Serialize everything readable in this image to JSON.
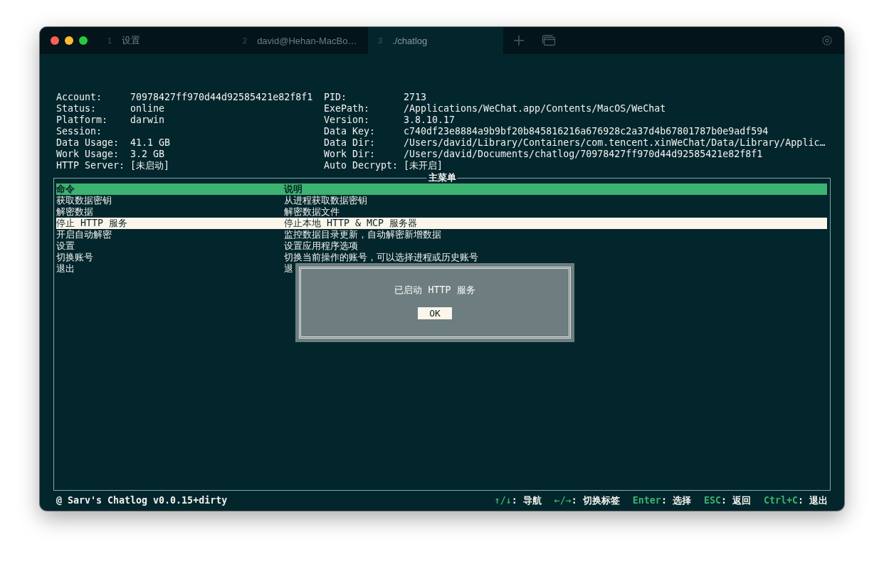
{
  "tabs": [
    {
      "number": "1",
      "title": "设置",
      "selected": false
    },
    {
      "number": "2",
      "title": "david@Hehan-MacBo…",
      "selected": false
    },
    {
      "number": "3",
      "title": "./chatlog",
      "selected": true
    }
  ],
  "info_left": [
    {
      "label": "Account:",
      "value": "70978427ff970d44d92585421e82f8f1"
    },
    {
      "label": "Status:",
      "value": "online"
    },
    {
      "label": "Platform:",
      "value": "darwin"
    },
    {
      "label": "Session:"
    },
    {
      "label": "Data Usage:",
      "value": "41.1 GB"
    },
    {
      "label": "Work Usage:",
      "value": "3.2 GB"
    },
    {
      "label": "HTTP Server:",
      "value": "[未启动]"
    }
  ],
  "info_right": [
    {
      "label": "PID:",
      "value": "2713"
    },
    {
      "label": "ExePath:",
      "value": "/Applications/WeChat.app/Contents/MacOS/WeChat"
    },
    {
      "label": "Version:",
      "value": "3.8.10.17"
    },
    {
      "label": "Data Key:",
      "value": "c740df23e8884a9b9bf20b845816216a676928c2a37d4b67801787b0e9adf594"
    },
    {
      "label": "Data Dir:",
      "value": "/Users/david/Library/Containers/com.tencent.xinWeChat/Data/Library/Applic…"
    },
    {
      "label": "Work Dir:",
      "value": "/Users/david/Documents/chatlog/70978427ff970d44d92585421e82f8f1"
    },
    {
      "label": "Auto Decrypt:",
      "value": "[未开启]"
    }
  ],
  "menu": {
    "title": "主菜单",
    "columns": [
      "命令",
      "说明"
    ],
    "rows": [
      {
        "command": "获取数据密钥",
        "description": "从进程获取数据密钥",
        "selected": false
      },
      {
        "command": "解密数据",
        "description": "解密数据文件",
        "selected": false
      },
      {
        "command": "停止 HTTP 服务",
        "description": "停止本地 HTTP & MCP 服务器",
        "selected": true
      },
      {
        "command": "开启自动解密",
        "description": "监控数据目录更新，自动解密新增数据",
        "selected": false
      },
      {
        "command": "设置",
        "description": "设置应用程序选项",
        "selected": false
      },
      {
        "command": "切换账号",
        "description": "切换当前操作的账号，可以选择进程或历史账号",
        "selected": false
      },
      {
        "command": "退出",
        "description": "退",
        "selected": false
      }
    ]
  },
  "dialog": {
    "message": "已启动 HTTP 服务",
    "button": "OK"
  },
  "footer": {
    "app": "@ Sarv's Chatlog v0.0.15+dirty",
    "hints": [
      {
        "key": "↑/↓",
        "action": ": 导航"
      },
      {
        "key": "←/→",
        "action": ": 切换标签"
      },
      {
        "key": "Enter",
        "action": ": 选择"
      },
      {
        "key": "ESC",
        "action": ": 返回"
      },
      {
        "key": "Ctrl+C",
        "action": ": 退出"
      }
    ]
  }
}
